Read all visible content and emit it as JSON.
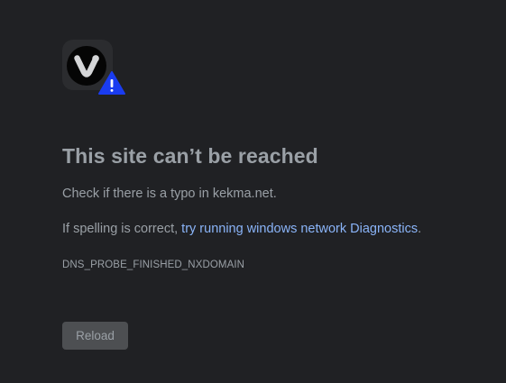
{
  "error": {
    "icon": "vivaldi-logo-with-warning-icon",
    "title": "This site can’t be reached",
    "check_text": "Check if there is a typo in kekma.net.",
    "spelling_prefix": "If spelling is correct, ",
    "diagnostics_link": "try running windows network Diagnostics",
    "spelling_suffix": ".",
    "error_code": "DNS_PROBE_FINISHED_NXDOMAIN",
    "reload_label": "Reload"
  },
  "colors": {
    "background": "#202124",
    "text": "#9aa0a6",
    "link": "#8ab4f8",
    "button": "#4d4f52",
    "warning_badge": "#1a3cf0"
  }
}
